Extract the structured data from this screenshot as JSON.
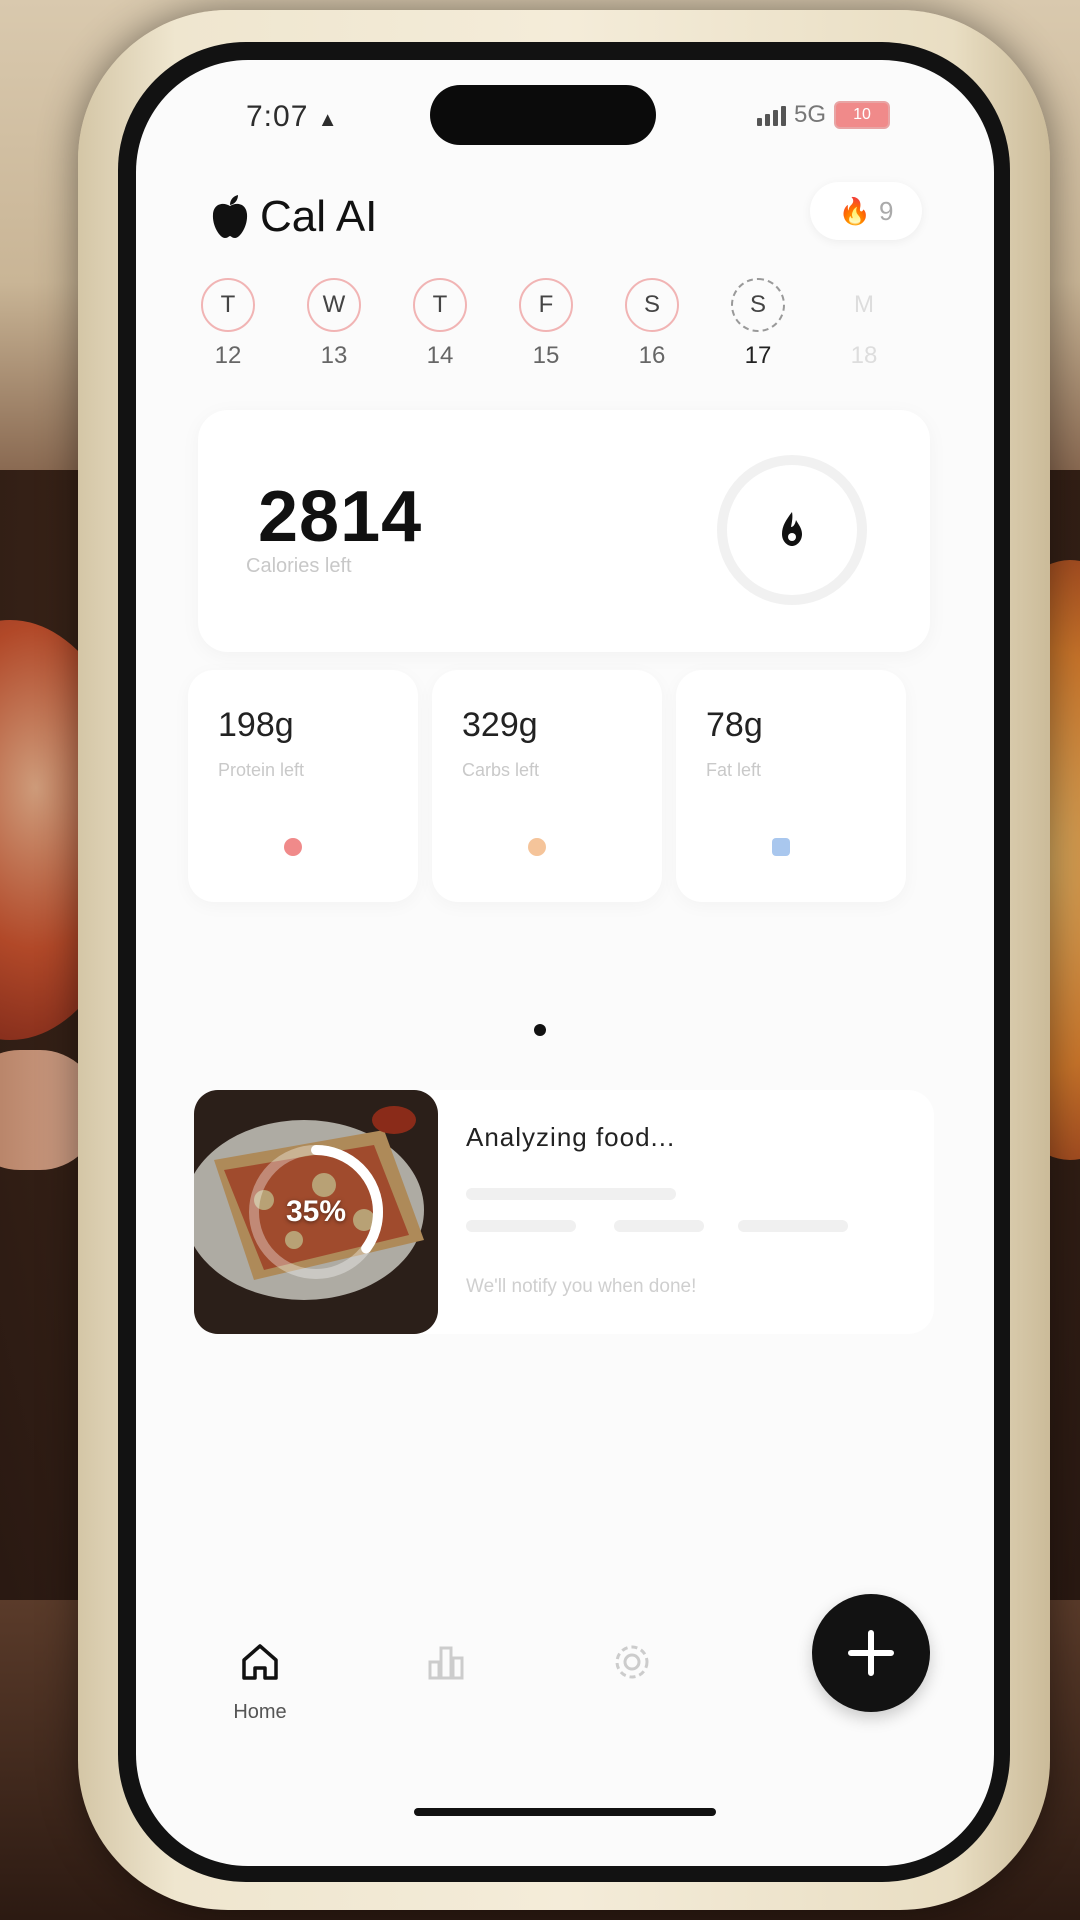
{
  "status_bar": {
    "time": "7:07",
    "network": "5G",
    "battery": "10"
  },
  "app": {
    "title": "Cal AI",
    "streak_count": "9"
  },
  "week": [
    {
      "letter": "T",
      "date": "12",
      "state": "logged"
    },
    {
      "letter": "W",
      "date": "13",
      "state": "logged"
    },
    {
      "letter": "T",
      "date": "14",
      "state": "logged"
    },
    {
      "letter": "F",
      "date": "15",
      "state": "logged"
    },
    {
      "letter": "S",
      "date": "16",
      "state": "logged"
    },
    {
      "letter": "S",
      "date": "17",
      "state": "today"
    },
    {
      "letter": "M",
      "date": "18",
      "state": "future"
    }
  ],
  "calories": {
    "value": "2814",
    "label": "Calories left"
  },
  "macros": [
    {
      "value": "198g",
      "label": "Protein left",
      "color": "#f08a8a"
    },
    {
      "value": "329g",
      "label": "Carbs left",
      "color": "#f5c49a"
    },
    {
      "value": "78g",
      "label": "Fat left",
      "color": "#a9c7ee"
    }
  ],
  "recent_food": {
    "progress_text": "35%",
    "progress_fraction": 0.35,
    "title": "Analyzing food...",
    "note": "We'll notify you when done!"
  },
  "nav": {
    "home": "Home"
  },
  "colors": {
    "accent_ring": "#f1b4b4",
    "fab": "#121212"
  },
  "icons": {
    "brand": "apple-icon",
    "streak": "flame-icon",
    "calorie": "flame-icon",
    "fab": "plus-icon"
  }
}
